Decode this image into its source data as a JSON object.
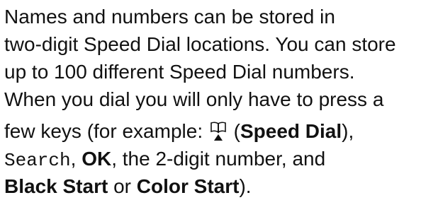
{
  "paragraph": {
    "line1": "Names and numbers can be stored in",
    "line2": "two-digit Speed Dial locations. You can store",
    "line3": "up to 100 different Speed Dial numbers.",
    "line4": "When you dial you will only have to press a",
    "line5_before": "few keys (for example: ",
    "line5_icon": "speed-dial-book-icon",
    "line5_open_paren": " (",
    "line5_bold": "Speed Dial",
    "line5_close": "),",
    "line6_mono": "Search",
    "line6_sep": ", ",
    "line6_bold": "OK",
    "line6_rest": ", the 2-digit number, and",
    "line7_bold1": "Black Start",
    "line7_or": " or ",
    "line7_bold2": "Color Start",
    "line7_end": ")."
  }
}
